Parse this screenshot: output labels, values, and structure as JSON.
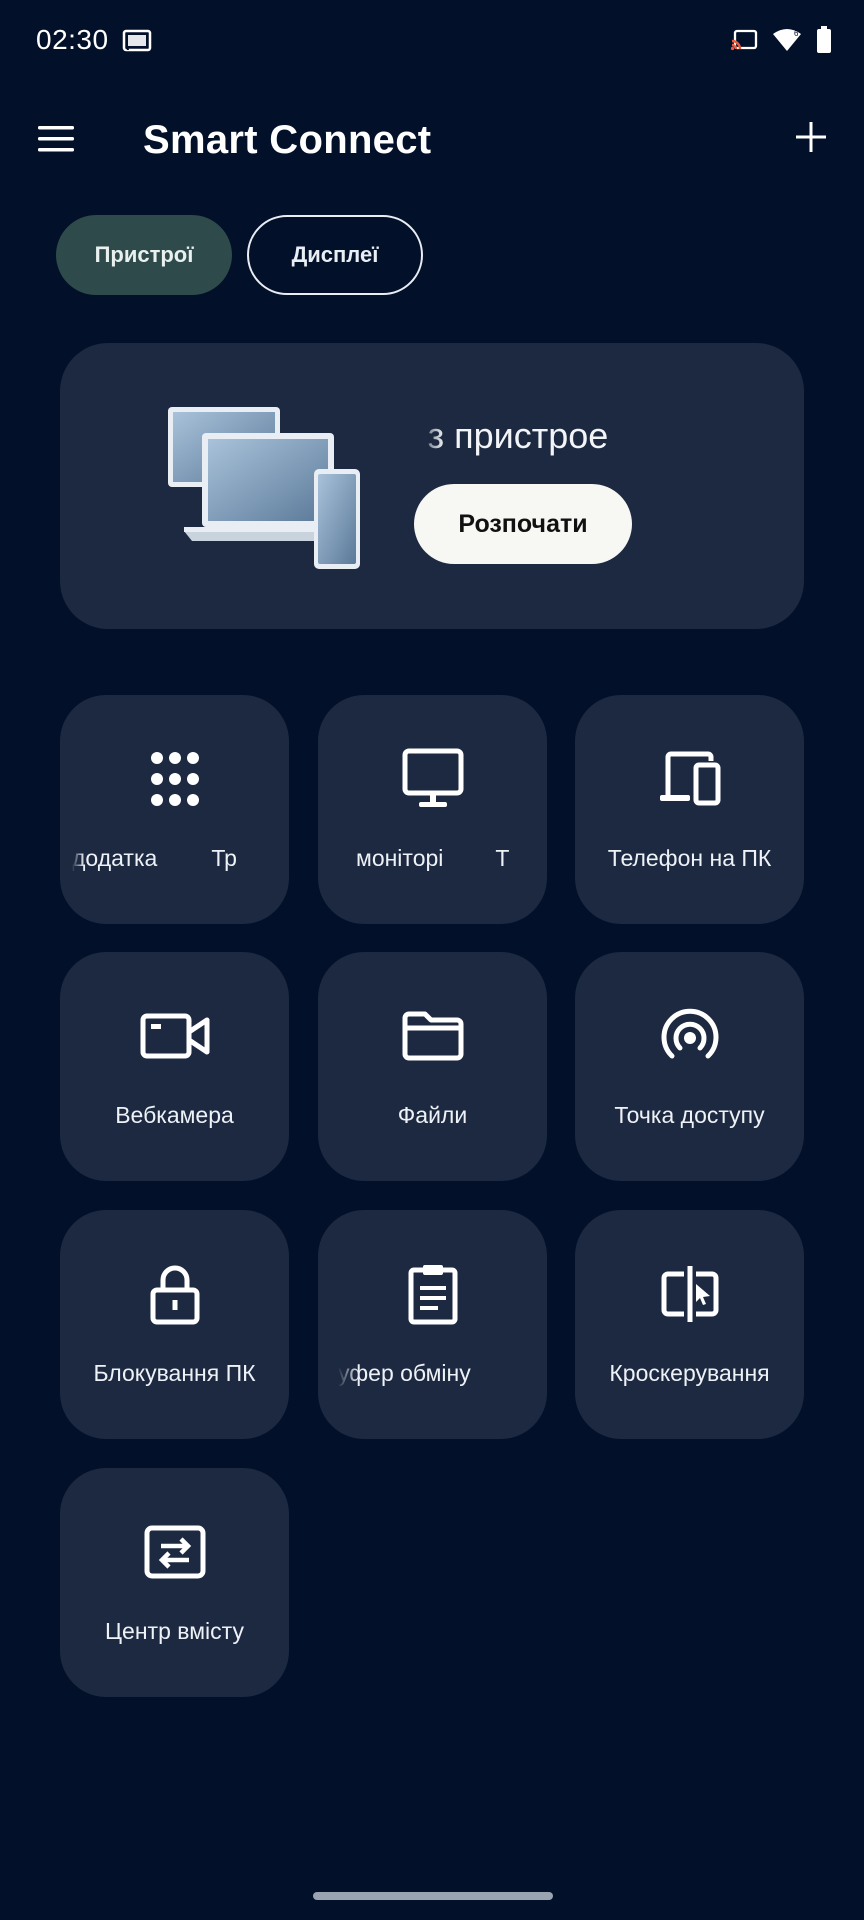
{
  "status_bar": {
    "time": "02:30",
    "icons": [
      "cast-icon",
      "screen-cast-icon",
      "wifi-icon",
      "battery-icon"
    ]
  },
  "app_bar": {
    "title": "Smart Connect",
    "menu_icon": "hamburger-icon",
    "add_icon": "plus-icon"
  },
  "tabs": [
    {
      "label": "Пристрої",
      "selected": true
    },
    {
      "label": "Дисплеї",
      "selected": false
    }
  ],
  "banner": {
    "text": "нити з пристрое",
    "button_label": "Розпочати"
  },
  "tiles": [
    {
      "label": "додатка",
      "label_next": "Тр",
      "icon": "apps-grid-icon"
    },
    {
      "label": "моніторі",
      "label_next": "Т",
      "icon": "monitor-icon"
    },
    {
      "label": "Телефон на ПК",
      "icon": "phone-to-pc-icon"
    },
    {
      "label": "Вебкамера",
      "icon": "webcam-icon"
    },
    {
      "label": "Файли",
      "icon": "folder-icon"
    },
    {
      "label": "Точка доступу",
      "icon": "hotspot-icon"
    },
    {
      "label": "Блокування ПК",
      "icon": "lock-icon"
    },
    {
      "label": "уфер обміну",
      "icon": "clipboard-icon"
    },
    {
      "label": "Кроскерування",
      "icon": "cross-control-icon"
    },
    {
      "label": "Центр вмісту",
      "icon": "content-center-icon"
    }
  ],
  "colors": {
    "background": "#021029",
    "card": "#1c2940",
    "chip_selected": "#2e4a4b",
    "button": "#f7f7f4"
  }
}
